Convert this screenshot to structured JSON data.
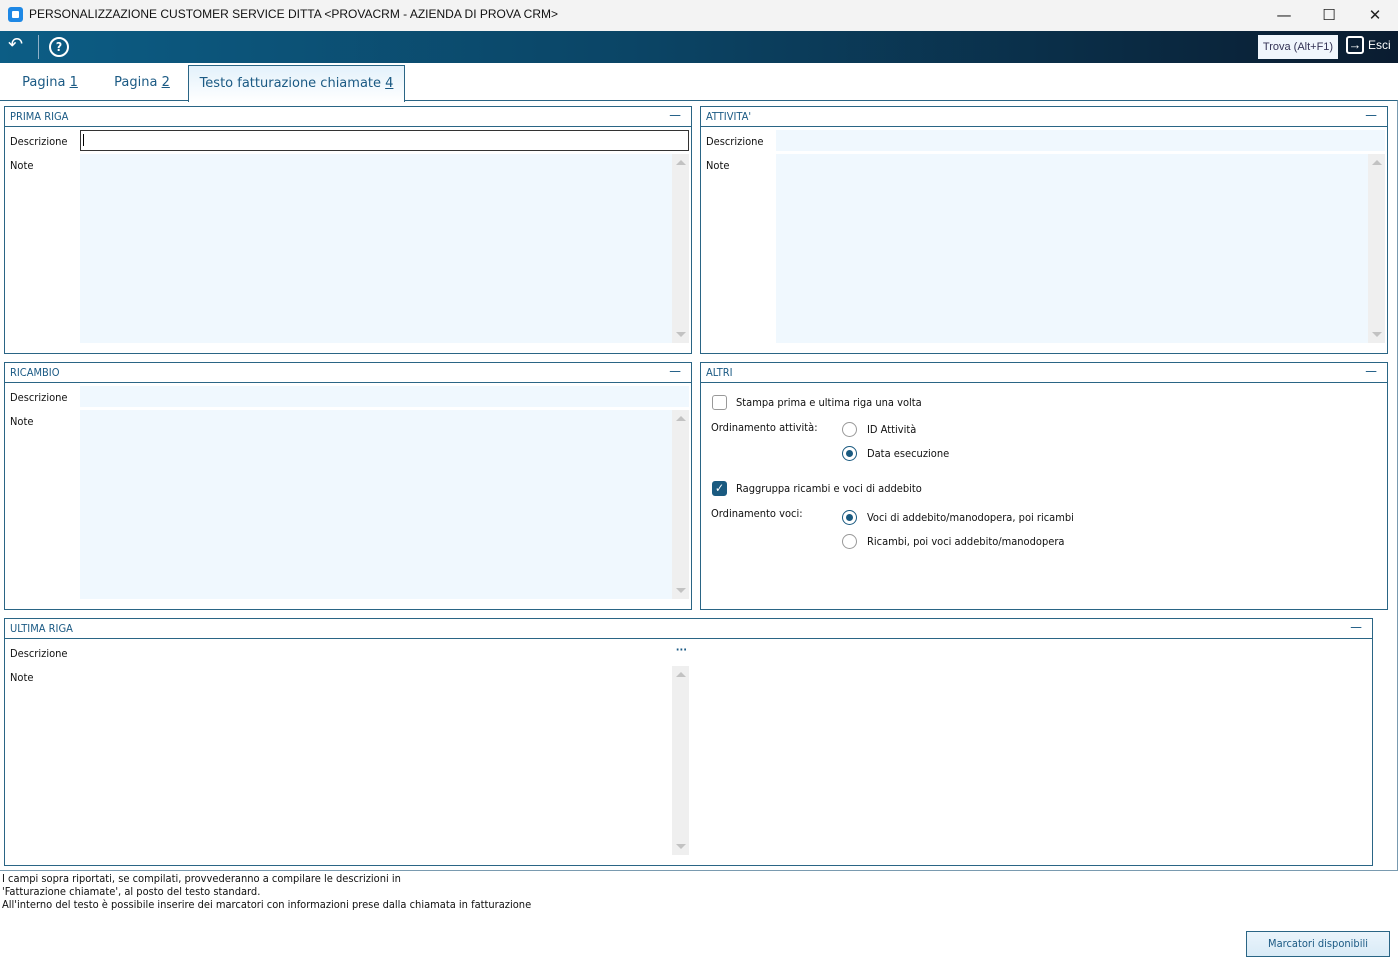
{
  "window": {
    "title": "PERSONALIZZAZIONE CUSTOMER SERVICE DITTA <PROVACRM - AZIENDA DI PROVA CRM>",
    "minimize": "—",
    "maximize": "☐",
    "close": "✕"
  },
  "toolbar": {
    "back_icon": "undo-icon",
    "help_icon": "help-icon",
    "find_label": "Trova (Alt+F1)",
    "exit_label": "Esci"
  },
  "tabs": [
    {
      "label": "Pagina ",
      "key": "1"
    },
    {
      "label": "Pagina ",
      "key": "2"
    },
    {
      "label": "Testo fatturazione chiamate ",
      "key": "4",
      "active": true
    }
  ],
  "panels": {
    "prima_riga": {
      "title": "PRIMA RIGA",
      "descrizione_label": "Descrizione",
      "note_label": "Note",
      "descrizione": "",
      "note": ""
    },
    "attivita": {
      "title": "ATTIVITA'",
      "descrizione_label": "Descrizione",
      "note_label": "Note",
      "descrizione": "",
      "note": ""
    },
    "ricambio": {
      "title": "RICAMBIO",
      "descrizione_label": "Descrizione",
      "note_label": "Note",
      "descrizione": "",
      "note": ""
    },
    "altri": {
      "title": "ALTRI",
      "stampa_label": "Stampa prima e ultima riga una volta",
      "stampa_checked": false,
      "ord_attivita_label": "Ordinamento attività:",
      "ord_attivita_options": [
        "ID Attività",
        "Data esecuzione"
      ],
      "ord_attivita_selected": 1,
      "raggruppa_label": "Raggruppa ricambi e voci di addebito",
      "raggruppa_checked": true,
      "ord_voci_label": "Ordinamento voci:",
      "ord_voci_options": [
        "Voci di addebito/manodopera, poi ricambi",
        "Ricambi, poi voci addebito/manodopera"
      ],
      "ord_voci_selected": 0
    },
    "ultima_riga": {
      "title": "ULTIMA RIGA",
      "descrizione_label": "Descrizione",
      "note_label": "Note",
      "ellipsis": "···"
    }
  },
  "minimize_symbol": "—",
  "footer": {
    "lines": [
      "I campi sopra riportati, se compilati, provvederanno a compilare le descrizioni in",
      "'Fatturazione chiamate', al posto del testo standard.",
      "All'interno del testo è possibile inserire dei marcatori con informazioni prese dalla chiamata in fatturazione"
    ],
    "markers_button": "Marcatori disponibili"
  }
}
